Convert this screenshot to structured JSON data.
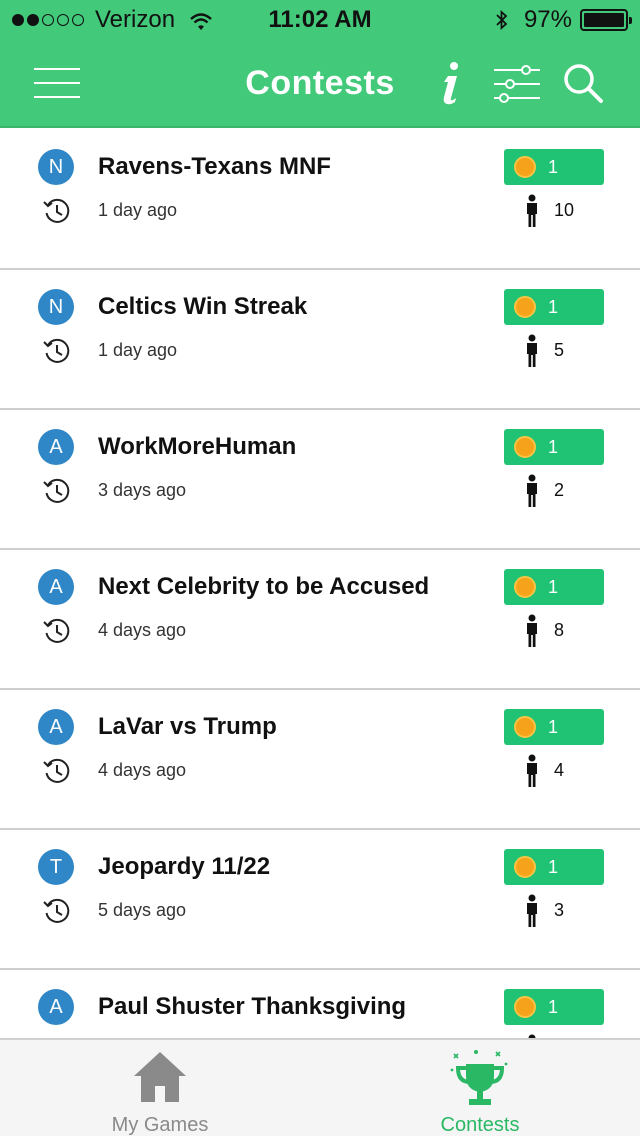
{
  "status_bar": {
    "carrier": "Verizon",
    "time": "11:02 AM",
    "battery": "97%",
    "signal_bars": 2,
    "signal_total": 5
  },
  "nav": {
    "title": "Contests",
    "icons": [
      "hamburger-menu-icon",
      "info-icon",
      "filter-sliders-icon",
      "search-icon"
    ]
  },
  "contests": [
    {
      "avatar": "N",
      "title": "Ravens-Texans MNF",
      "ago": "1 day ago",
      "badge": "1",
      "players": "10"
    },
    {
      "avatar": "N",
      "title": "Celtics Win Streak",
      "ago": "1 day ago",
      "badge": "1",
      "players": "5"
    },
    {
      "avatar": "A",
      "title": "WorkMoreHuman",
      "ago": "3 days ago",
      "badge": "1",
      "players": "2"
    },
    {
      "avatar": "A",
      "title": "Next Celebrity to be Accused",
      "ago": "4 days ago",
      "badge": "1",
      "players": "8"
    },
    {
      "avatar": "A",
      "title": "LaVar vs Trump",
      "ago": "4 days ago",
      "badge": "1",
      "players": "4"
    },
    {
      "avatar": "T",
      "title": "Jeopardy 11/22",
      "ago": "5 days ago",
      "badge": "1",
      "players": "3"
    },
    {
      "avatar": "A",
      "title": "Paul Shuster Thanksgiving",
      "ago": "",
      "badge": "1",
      "players": ""
    }
  ],
  "tabs": {
    "games_label": "My Games",
    "contests_label": "Contests",
    "active": "contests"
  },
  "colors": {
    "header_green": "#43c97a",
    "badge_green": "#1fc373",
    "avatar_blue": "#2f87c7",
    "coin_orange": "#f6a21a",
    "active_tab": "#2bb865",
    "inactive_tab": "#8a8a8a"
  }
}
